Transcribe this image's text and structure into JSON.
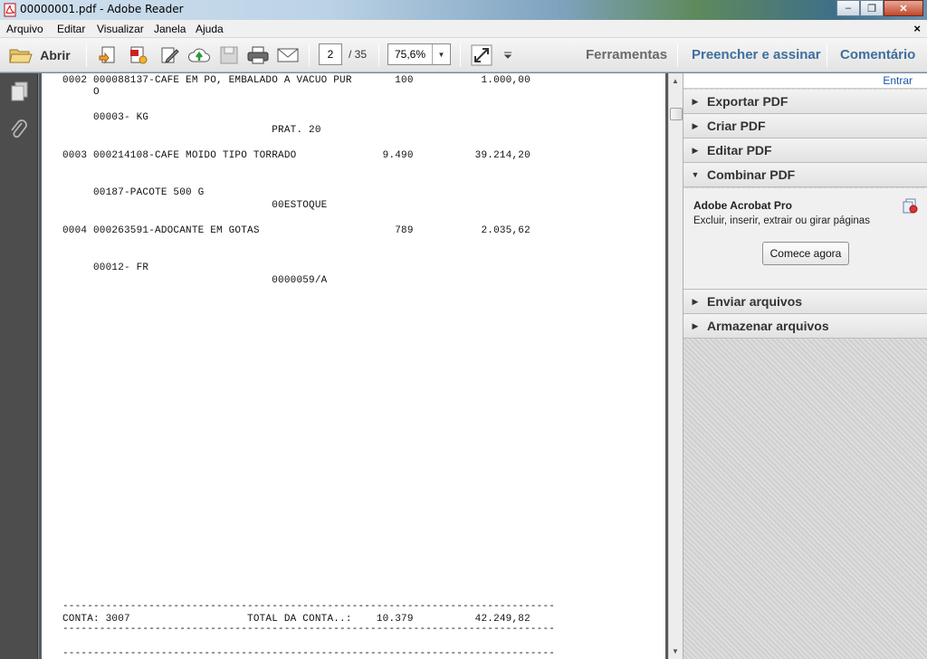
{
  "window": {
    "title": "00000001.pdf - Adobe Reader"
  },
  "menu": {
    "items": [
      "Arquivo",
      "Editar",
      "Visualizar",
      "Janela",
      "Ajuda"
    ],
    "close_glyph": "×"
  },
  "toolbar": {
    "open_label": "Abrir",
    "page_current": "2",
    "page_total": "/ 35",
    "zoom": "75,6%",
    "tools_label": "Ferramentas",
    "fill_sign_label": "Preencher e assinar",
    "comment_label": "Comentário"
  },
  "document": {
    "lines": [
      "0002 000088137-CAFE EM PO, EMBALADO A VACUO PUR       100           1.000,00",
      "     O",
      "     00003- KG",
      "                                  PRAT. 20",
      "0003 000214108-CAFE MOIDO TIPO TORRADO              9.490          39.214,20",
      "     00187-PACOTE 500 G",
      "                                  00ESTOQUE",
      "0004 000263591-ADOCANTE EM GOTAS                      789           2.035,62",
      "     00012- FR",
      "                                  0000059/A",
      "--------------------------------------------------------------------------------",
      "CONTA: 3007                   TOTAL DA CONTA..:    10.379          42.249,82",
      "--------------------------------------------------------------------------------",
      "--------------------------------------------------------------------------------"
    ]
  },
  "right_panel": {
    "sign_in": "Entrar",
    "sections": [
      {
        "label": "Exportar PDF",
        "expanded": false
      },
      {
        "label": "Criar PDF",
        "expanded": false
      },
      {
        "label": "Editar PDF",
        "expanded": false
      },
      {
        "label": "Combinar PDF",
        "expanded": true
      },
      {
        "label": "Enviar arquivos",
        "expanded": false
      },
      {
        "label": "Armazenar arquivos",
        "expanded": false
      }
    ],
    "combine": {
      "title": "Adobe Acrobat Pro",
      "description": "Excluir, inserir, extrair ou girar páginas",
      "button": "Comece agora"
    }
  }
}
